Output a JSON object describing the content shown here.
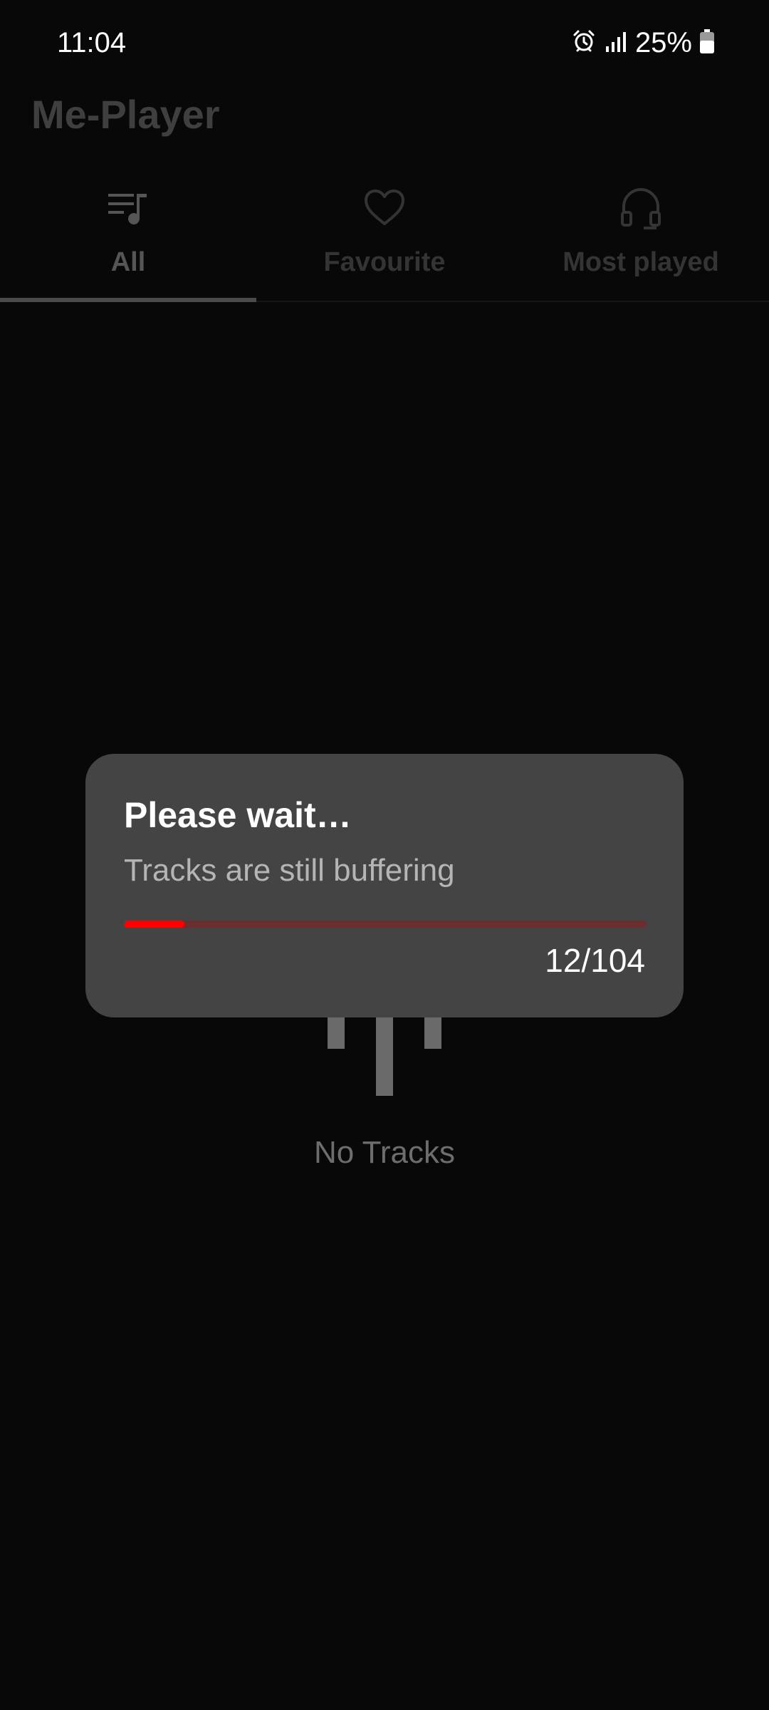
{
  "status_bar": {
    "time": "11:04",
    "battery_percent": "25%",
    "icons": [
      "alarm-icon",
      "signal-icon",
      "battery-icon"
    ]
  },
  "app": {
    "title": "Me-Player"
  },
  "tabs": [
    {
      "label": "All",
      "icon": "playlist-music-icon",
      "active": true
    },
    {
      "label": "Favourite",
      "icon": "heart-icon",
      "active": false
    },
    {
      "label": "Most played",
      "icon": "headphones-icon",
      "active": false
    }
  ],
  "empty_state": {
    "text": "No Tracks",
    "icon": "equalizer-bars-icon"
  },
  "dialog": {
    "title": "Please wait…",
    "message": "Tracks are still buffering",
    "progress": {
      "current": 12,
      "total": 104,
      "label": "12/104"
    }
  },
  "colors": {
    "background": "#080808",
    "dialog_background": "#444444",
    "progress_fill": "#ff0000",
    "progress_track": "#6a2e2e"
  }
}
